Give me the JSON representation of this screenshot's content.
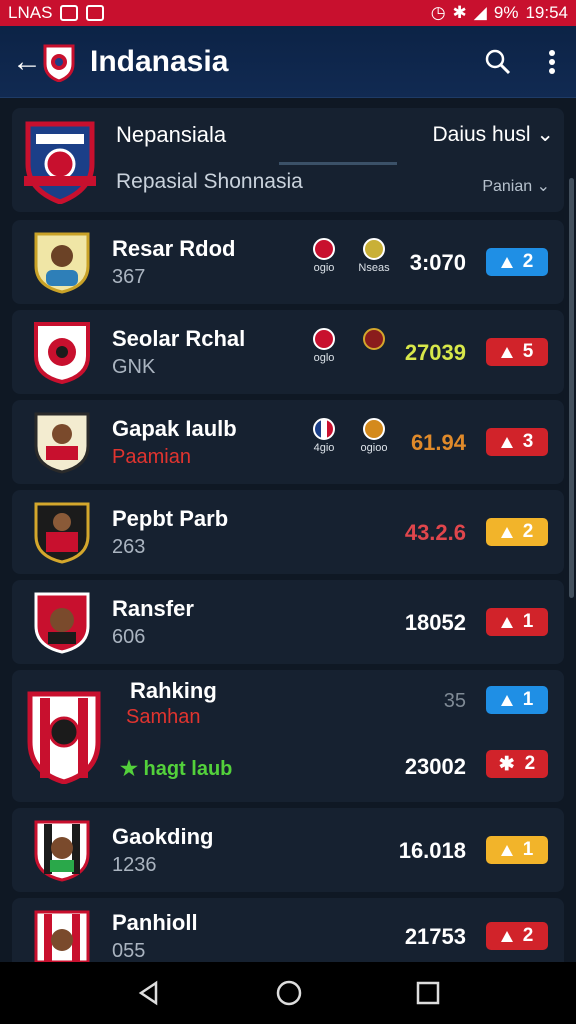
{
  "status_bar": {
    "left_text": "LNAS",
    "battery": "9%",
    "time": "19:54"
  },
  "appbar": {
    "title": "Indanasia",
    "back_icon": "back-arrow-icon",
    "search_icon": "search-icon",
    "menu_icon": "more-vert-icon"
  },
  "header": {
    "title": "Nepansiala",
    "subtitle": "Repasial Shonnasia",
    "dropdown1": "Daius husl",
    "dropdown2": "Panian"
  },
  "rows": [
    {
      "name": "Resar Rdod",
      "sub": "367",
      "m1": "ogio",
      "m2": "Nseas",
      "score": "3:070",
      "score_color": "#ffffff",
      "pill": "2",
      "pill_color": "#1f8fe5"
    },
    {
      "name": "Seolar Rchal",
      "sub": "GNK",
      "m1": "oglo",
      "m2": "",
      "score": "27039",
      "score_color": "#d8e84a",
      "pill": "5",
      "pill_color": "#d1232a"
    },
    {
      "name": "Gapak Iaulb",
      "sub": "Paamian",
      "m1": "4gio",
      "m2": "ogioo",
      "score": "61.94",
      "score_color": "#e08a2a",
      "pill": "3",
      "pill_color": "#d1232a"
    },
    {
      "name": "Pepbt Parb",
      "sub": "263",
      "score": "43.2.6",
      "score_color": "#e0464c",
      "pill": "2",
      "pill_color": "#f2b42a"
    },
    {
      "name": "Ransfer",
      "sub": "606",
      "score": "18052",
      "score_color": "#ffffff",
      "pill": "1",
      "pill_color": "#d1232a"
    },
    {
      "name": "Rahking",
      "sub": "Samhan",
      "extra": "★ hagt laub",
      "rank_score": "35",
      "score": "23002",
      "score_color": "#ffffff",
      "pill": "1",
      "pill_color": "#1f8fe5",
      "pill2": "2",
      "pill2_color": "#d1232a"
    },
    {
      "name": "Gaokding",
      "sub": "1236",
      "score": "16.018",
      "score_color": "#ffffff",
      "pill": "1",
      "pill_color": "#f2b42a"
    },
    {
      "name": "Panhioll",
      "sub": "055",
      "score": "21753",
      "score_color": "#ffffff",
      "pill": "2",
      "pill_color": "#d1232a"
    }
  ],
  "nav": {
    "back": "nav-back-icon",
    "home": "nav-home-icon",
    "recents": "nav-recents-icon"
  }
}
